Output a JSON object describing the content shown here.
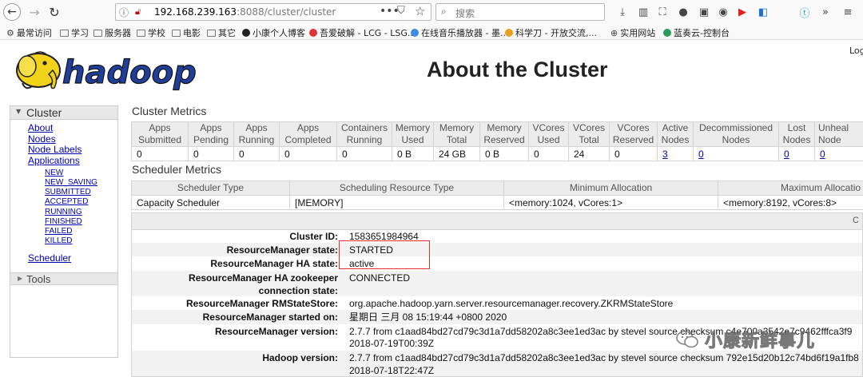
{
  "browser": {
    "url_host": "192.168.239.163",
    "url_path": ":8088/cluster/cluster",
    "url_more": "•••",
    "search_placeholder": "搜索",
    "bookmarks": [
      {
        "label": "最常访问",
        "icon": "gear-icon"
      },
      {
        "label": "学习",
        "icon": "folder-icon"
      },
      {
        "label": "服务器",
        "icon": "folder-icon"
      },
      {
        "label": "学校",
        "icon": "folder-icon"
      },
      {
        "label": "电影",
        "icon": "folder-icon"
      },
      {
        "label": "其它",
        "icon": "folder-icon"
      },
      {
        "label": "小康个人博客",
        "icon": "site-icon"
      },
      {
        "label": "吾爱破解 - LCG - LSG...",
        "icon": "site-icon"
      },
      {
        "label": "在线音乐播放器 - 墨...",
        "icon": "site-icon"
      },
      {
        "label": "科学刀 - 开放交流,...",
        "icon": "site-icon"
      },
      {
        "label": "实用网站",
        "icon": "globe-icon"
      },
      {
        "label": "蓝奏云-控制台",
        "icon": "site-icon"
      }
    ]
  },
  "page": {
    "logo_text": "hadoop",
    "title": "About the Cluster",
    "login_cut": "Log"
  },
  "sidebar": {
    "cluster_label": "Cluster",
    "links": [
      "About",
      "Nodes",
      "Node Labels",
      "Applications"
    ],
    "app_states": [
      "NEW",
      "NEW_SAVING",
      "SUBMITTED",
      "ACCEPTED",
      "RUNNING",
      "FINISHED",
      "FAILED",
      "KILLED"
    ],
    "scheduler": "Scheduler",
    "tools_label": "Tools"
  },
  "cluster_metrics": {
    "title": "Cluster Metrics",
    "headers": [
      [
        "Apps",
        "Submitted"
      ],
      [
        "Apps",
        "Pending"
      ],
      [
        "Apps",
        "Running"
      ],
      [
        "Apps",
        "Completed"
      ],
      [
        "Containers",
        "Running"
      ],
      [
        "Memory",
        "Used"
      ],
      [
        "Memory",
        "Total"
      ],
      [
        "Memory",
        "Reserved"
      ],
      [
        "VCores",
        "Used"
      ],
      [
        "VCores",
        "Total"
      ],
      [
        "VCores",
        "Reserved"
      ],
      [
        "Active",
        "Nodes"
      ],
      [
        "Decommissioned",
        "Nodes"
      ],
      [
        "Lost",
        "Nodes"
      ],
      [
        "Unheal",
        "Node"
      ]
    ],
    "values": [
      "0",
      "0",
      "0",
      "0",
      "0",
      "0 B",
      "24 GB",
      "0 B",
      "0",
      "24",
      "0",
      "3",
      "0",
      "0",
      "0"
    ]
  },
  "scheduler_metrics": {
    "title": "Scheduler Metrics",
    "headers": [
      "Scheduler Type",
      "Scheduling Resource Type",
      "Minimum Allocation",
      "Maximum Allocatio"
    ],
    "values": [
      "Capacity Scheduler",
      "[MEMORY]",
      "<memory:1024, vCores:1>",
      "<memory:8192, vCores:8>"
    ]
  },
  "cluster_info": {
    "header_cut": "C",
    "rows": [
      {
        "label": "Cluster ID:",
        "value": "1583651984964"
      },
      {
        "label": "ResourceManager state:",
        "value": "STARTED"
      },
      {
        "label": "ResourceManager HA state:",
        "value": "active"
      },
      {
        "label": "ResourceManager HA zookeeper connection state:",
        "value": "CONNECTED"
      },
      {
        "label": "ResourceManager RMStateStore:",
        "value": "org.apache.hadoop.yarn.server.resourcemanager.recovery.ZKRMStateStore"
      },
      {
        "label": "ResourceManager started on:",
        "value": "星期日 三月 08 15:19:44 +0800 2020"
      },
      {
        "label": "ResourceManager version:",
        "value": "2.7.7 from c1aad84bd27cd79c3d1a7dd58202a8c3ee1ed3ac by stevel source checksum c4e700a3542e7c9462fffca3f9",
        "value2": "2018-07-19T00:39Z"
      },
      {
        "label": "Hadoop version:",
        "value": "2.7.7 from c1aad84bd27cd79c3d1a7dd58202a8c3ee1ed3ac by stevel source checksum 792e15d20b12c74bd6f19a1fb8",
        "value2": "2018-07-18T22:47Z"
      }
    ]
  },
  "watermark": "小康新鲜事儿"
}
